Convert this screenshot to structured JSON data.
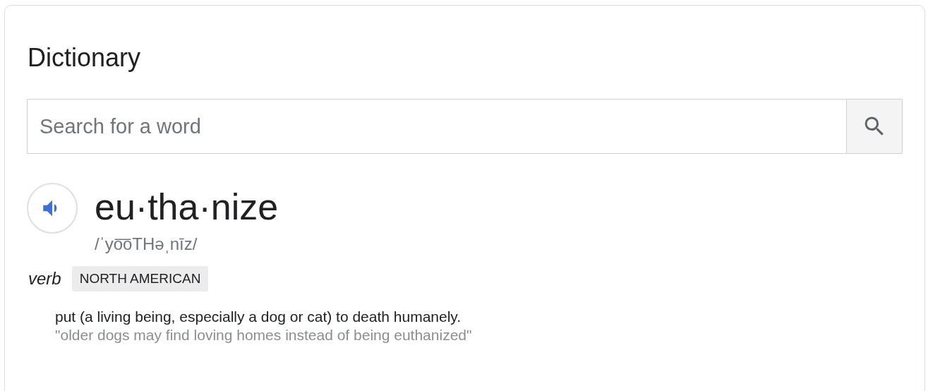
{
  "title": "Dictionary",
  "search": {
    "placeholder": "Search for a word"
  },
  "entry": {
    "word": "eu·tha·nize",
    "pronunciation": "/ˈyo͞oTHəˌnīz/",
    "part_of_speech": "verb",
    "label": "NORTH AMERICAN",
    "definitions": [
      {
        "text": "put (a living being, especially a dog or cat) to death humanely.",
        "example": "\"older dogs may find loving homes instead of being euthanized\""
      }
    ]
  }
}
